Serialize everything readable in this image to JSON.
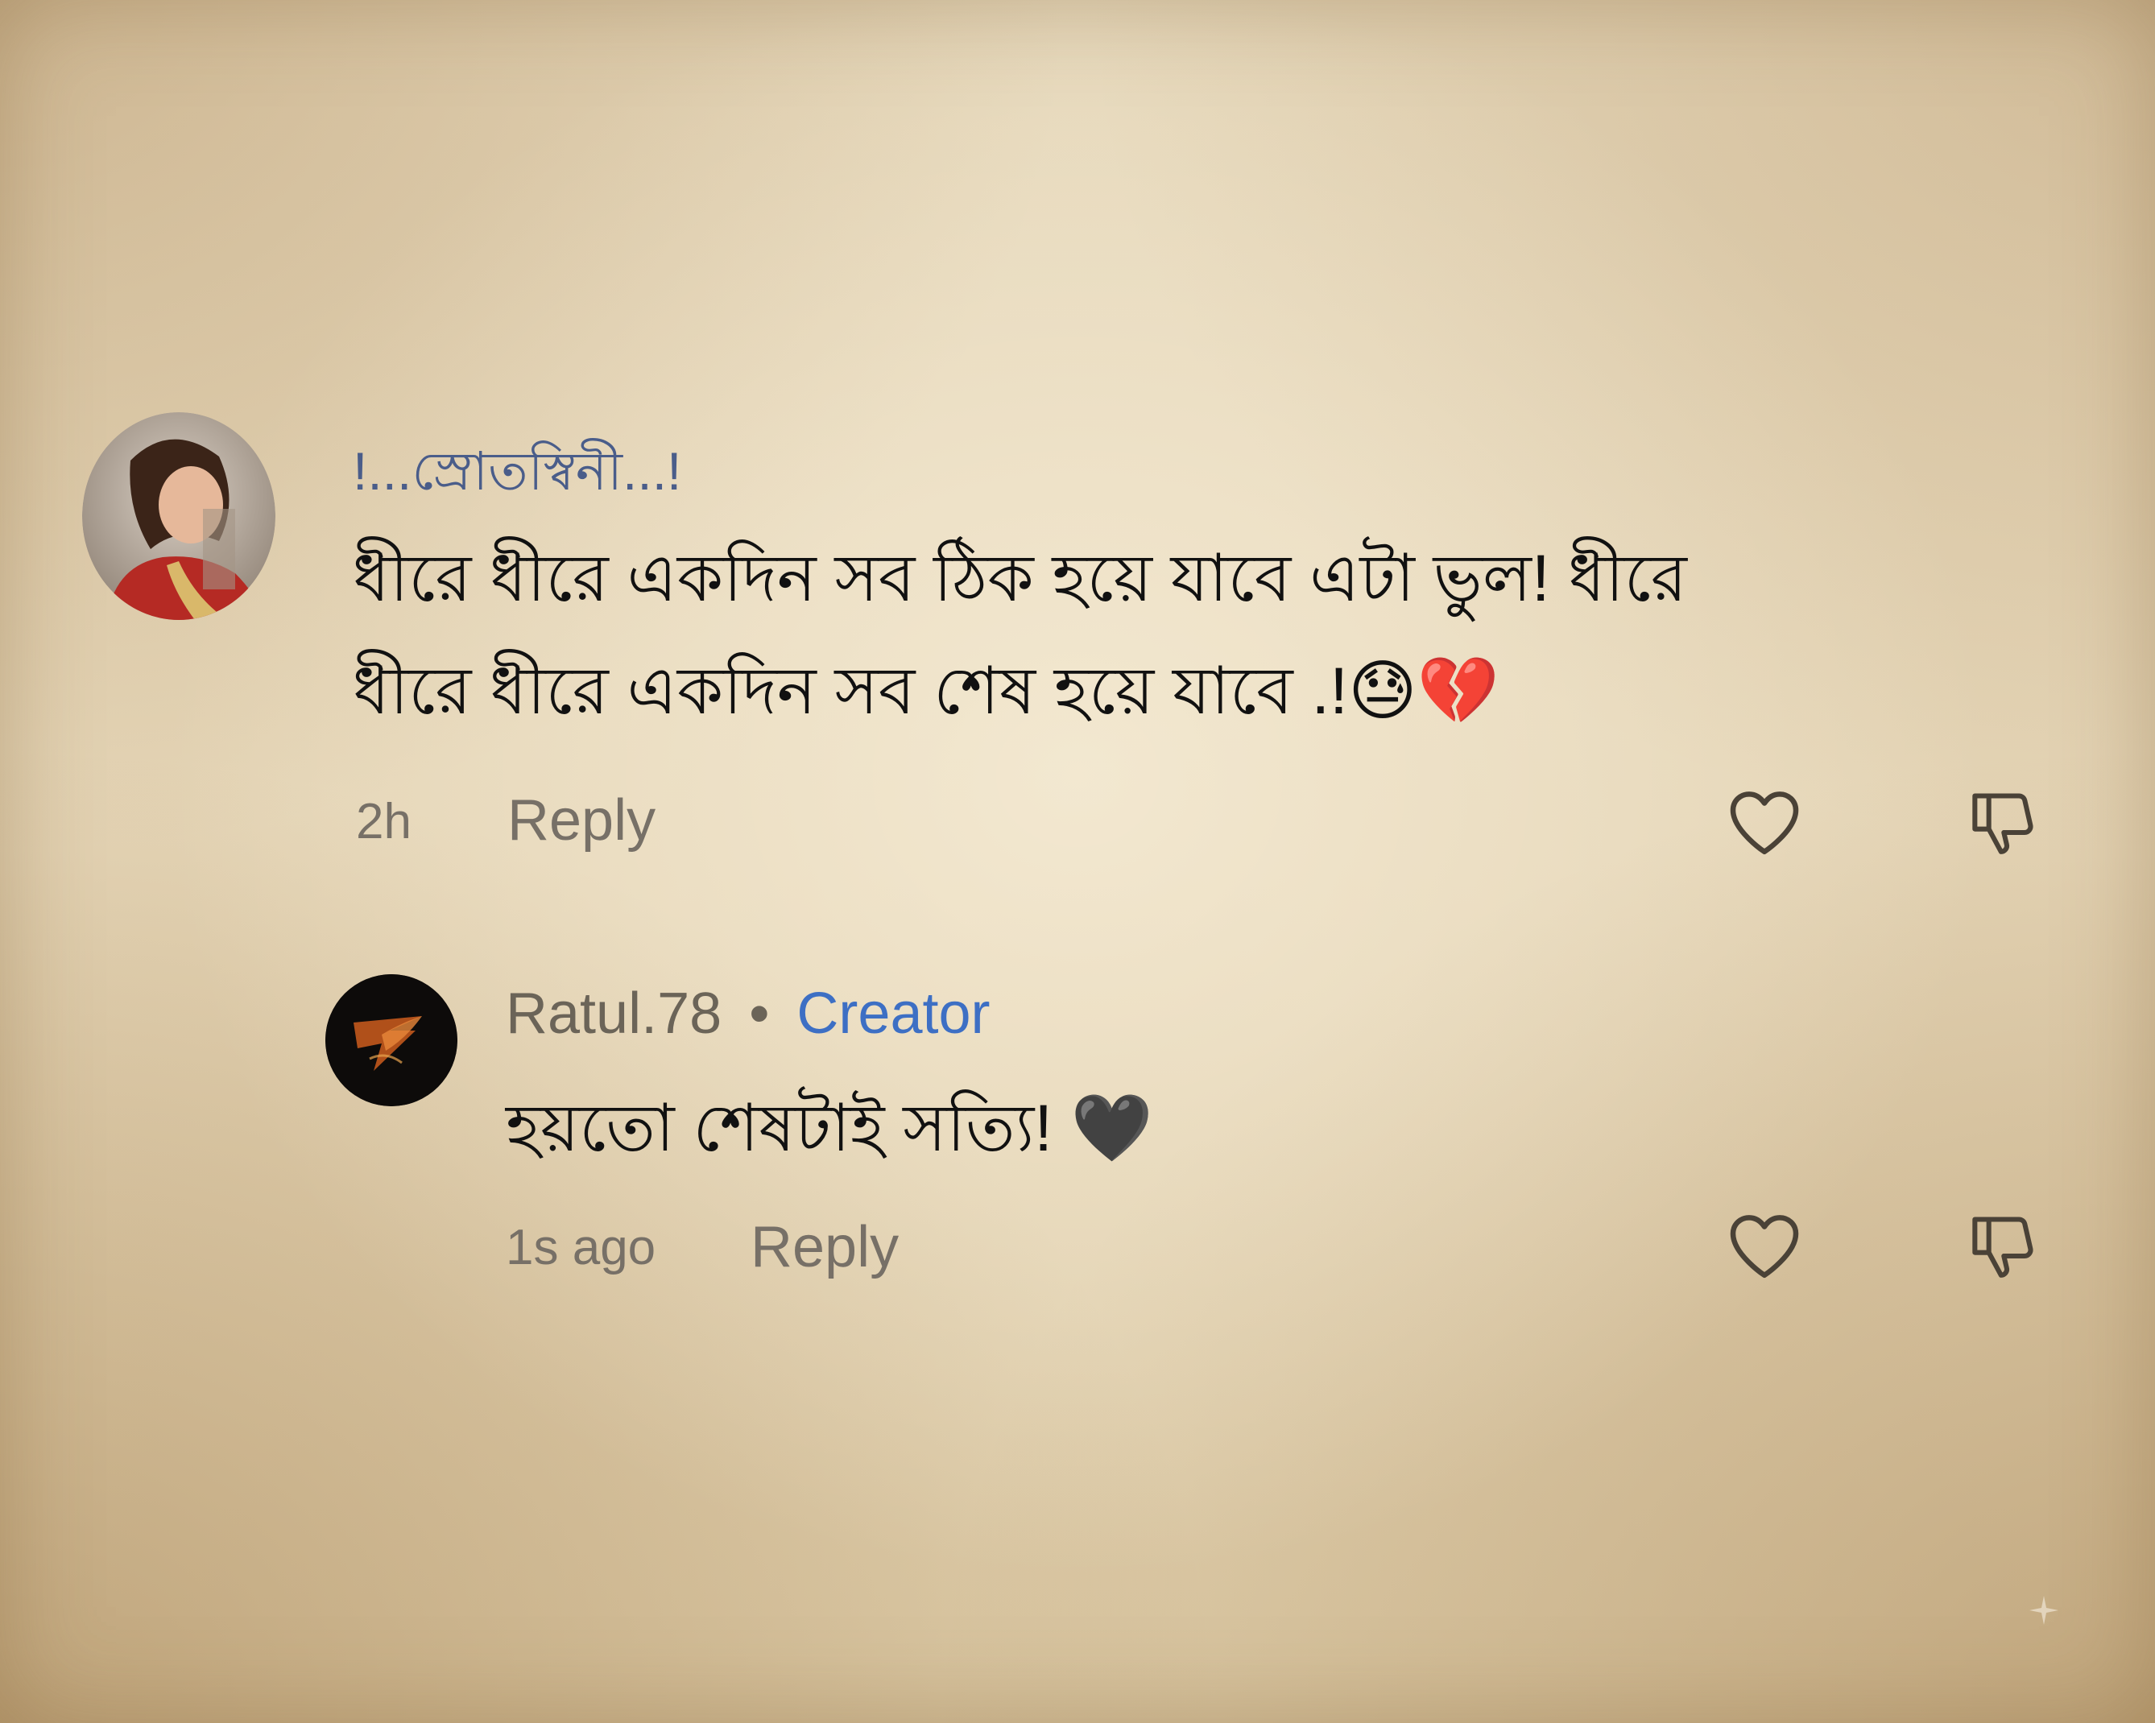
{
  "comments": [
    {
      "username": "!...স্রোতস্বিনী...!",
      "text_line1": "ধীরে ধীরে একদিন সব ঠিক হয়ে যাবে এটা ভুল! ধীরে",
      "text_line2": "ধীরে ধীরে একদিন সব শেষ হয়ে যাবে .!😓💔",
      "time": "2h",
      "reply_label": "Reply",
      "avatar_icon": "user-photo-avatar",
      "like_icon": "heart-outline-icon",
      "dislike_icon": "thumbs-down-outline-icon"
    },
    {
      "username": "Ratul.78",
      "separator": "•",
      "badge": "Creator",
      "text": "হয়তো শেষটাই সত্যি! 🖤",
      "time": "1s ago",
      "reply_label": "Reply",
      "avatar_icon": "fire-logo-avatar",
      "like_icon": "heart-outline-icon",
      "dislike_icon": "thumbs-down-outline-icon"
    }
  ],
  "colors": {
    "background": "#e2d2b4",
    "text": "#111111",
    "muted": "#777067",
    "creator_badge": "#3d6fc4",
    "icon_stroke": "#4a4237"
  }
}
